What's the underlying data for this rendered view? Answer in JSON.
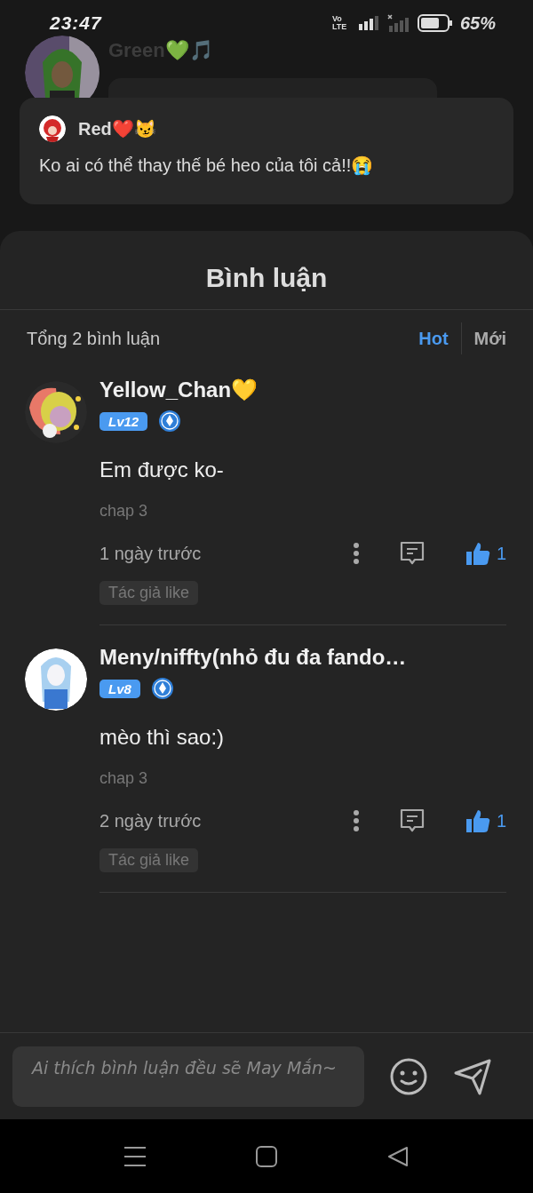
{
  "status_bar": {
    "time": "23:47",
    "network": "Vo LTE",
    "battery": "65%"
  },
  "background": {
    "author": "Green💚🎵"
  },
  "quoted_comment": {
    "author": "Red❤️😼",
    "text": "Ko ai có thể thay thế bé heo của tôi cả!!😭"
  },
  "sheet": {
    "title": "Bình luận",
    "total": "Tổng 2 bình luận",
    "sort_tabs": [
      {
        "label": "Hot",
        "selected": true
      },
      {
        "label": "Mới",
        "selected": false
      }
    ],
    "comments": [
      {
        "author": "Yellow_Chan💛",
        "level": "Lv12",
        "text": "Em được ko-",
        "chapter": "chap 3",
        "time": "1 ngày trước",
        "likes": "1",
        "liked": true,
        "tag": "Tác giả like"
      },
      {
        "author": "Meny/niffty(nhỏ đu đa fando…",
        "level": "Lv8",
        "text": "mèo thì sao:)",
        "chapter": "chap 3",
        "time": "2 ngày trước",
        "likes": "1",
        "liked": true,
        "tag": "Tác giả like"
      }
    ]
  },
  "composer": {
    "placeholder": "Ai thích bình luận đều sẽ May Mắn~"
  }
}
